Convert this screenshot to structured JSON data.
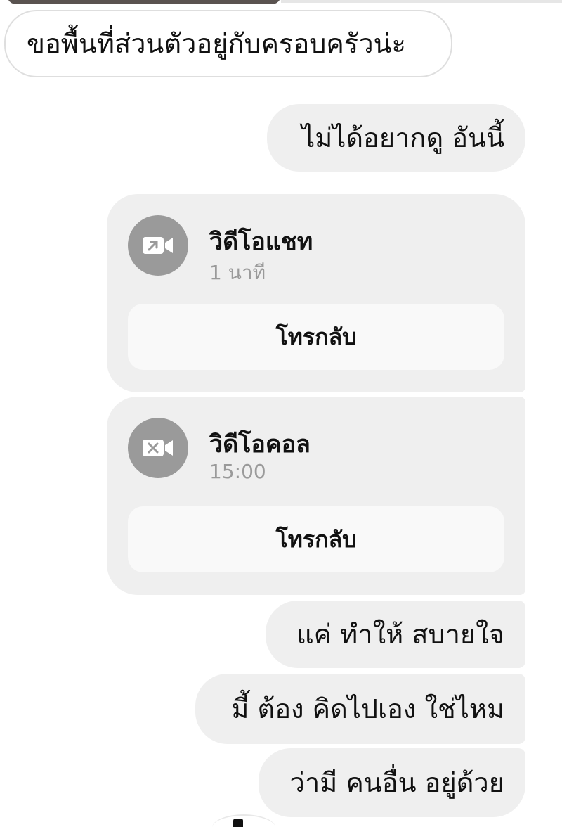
{
  "messages": {
    "received_1": "ขอพื้นที่ส่วนตัวอยู่กับครอบครัวน่ะ",
    "sent_1": "ไม่ได้อยากดู อันนี้",
    "sent_2": "แค่ ทำให้ สบายใจ",
    "sent_3": "มี้ ต้อง คิดไปเอง ใช่ไหม",
    "sent_4": "ว่ามี คนอื่น อยู่ด้วย"
  },
  "calls": [
    {
      "title": "วิดีโอแชท",
      "duration": "1 นาที",
      "callback_label": "โทรกลับ",
      "icon": "video-call-outgoing-icon"
    },
    {
      "title": "วิดีโอคอล",
      "duration": "15:00",
      "callback_label": "โทรกลับ",
      "icon": "video-call-missed-icon"
    }
  ],
  "colors": {
    "incoming_bubble_border": "#dedede",
    "outgoing_bubble": "#efefef",
    "call_icon_bg": "#9a9a9a",
    "callback_button_bg": "#f9f9f9"
  }
}
